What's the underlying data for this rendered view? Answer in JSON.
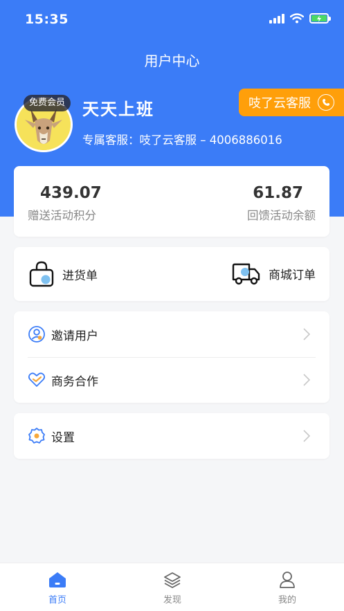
{
  "status_bar": {
    "time": "15:35"
  },
  "header": {
    "title": "用户中心"
  },
  "profile": {
    "member_badge": "免费会员",
    "name": "天天上班",
    "service_line": "专属客服：吱了云客服 – 4006886016",
    "service_button_label": "吱了云客服"
  },
  "stats": [
    {
      "value": "439.07",
      "label": "赠送活动积分"
    },
    {
      "value": "61.87",
      "label": "回馈活动余额"
    }
  ],
  "orders": [
    {
      "label": "进货单",
      "icon": "shopping-bag-icon"
    },
    {
      "label": "商城订单",
      "icon": "delivery-truck-icon"
    }
  ],
  "menu": [
    {
      "label": "邀请用户",
      "icon": "user-circle-icon"
    },
    {
      "label": "商务合作",
      "icon": "handshake-heart-icon"
    },
    {
      "label": "设置",
      "icon": "gear-icon"
    }
  ],
  "tabs": [
    {
      "label": "首页",
      "icon": "home-icon",
      "active": true
    },
    {
      "label": "发现",
      "icon": "layers-icon",
      "active": false
    },
    {
      "label": "我的",
      "icon": "person-icon",
      "active": false
    }
  ],
  "colors": {
    "primary": "#3b7cf7",
    "accent_orange": "#ff9f0a",
    "background": "#f5f6f8"
  }
}
